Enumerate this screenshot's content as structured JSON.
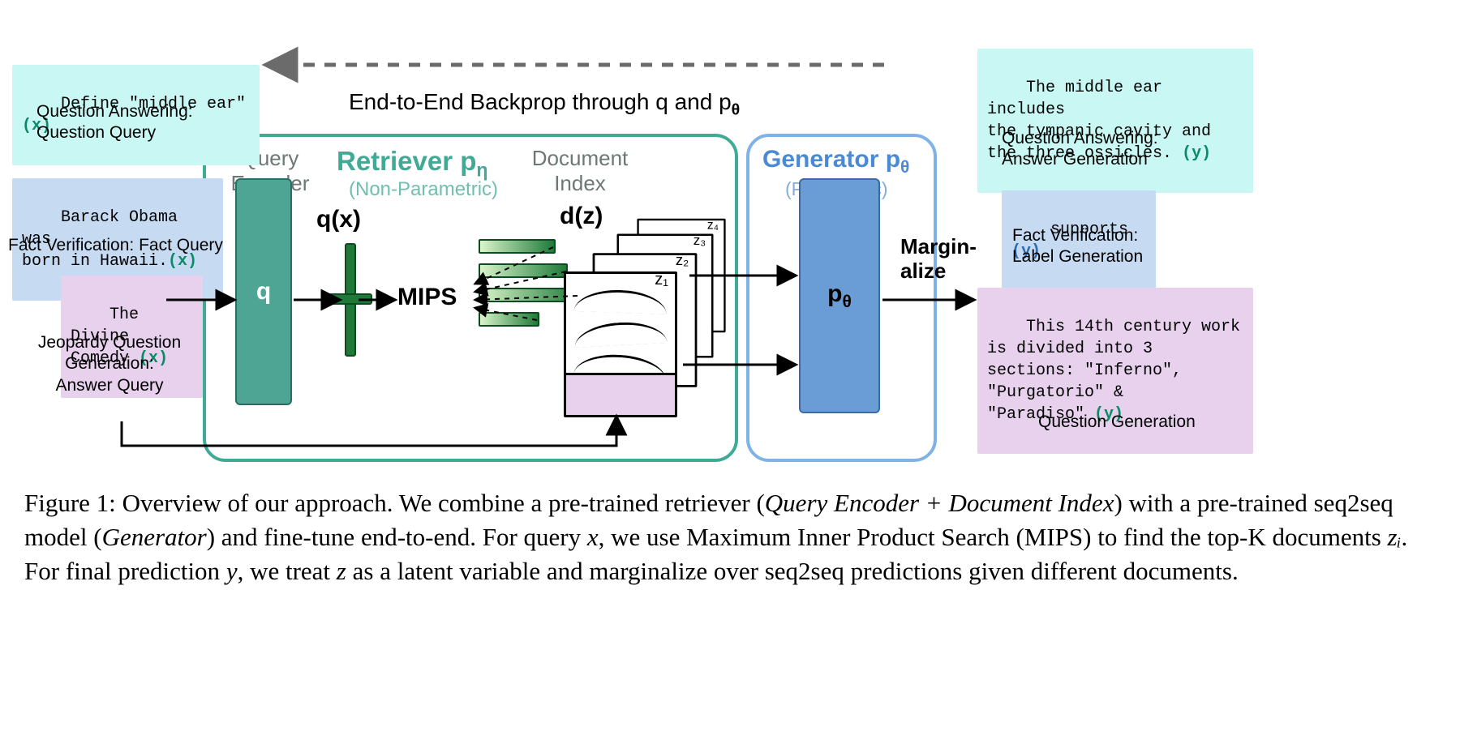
{
  "backprop_text": "End-to-End Backprop through q and p",
  "backprop_sub": "θ",
  "retriever": {
    "title_prefix": "Retriever p",
    "title_sub": "η",
    "subtitle": "(Non-Parametric)"
  },
  "query_encoder": {
    "title": "Query Encoder",
    "block_label": "q"
  },
  "doc_index": {
    "title": "Document Index"
  },
  "generator": {
    "title_prefix": "Generator p",
    "title_sub": "θ",
    "subtitle": "(Parametric)",
    "block_prefix": "p",
    "block_sub": "θ"
  },
  "math": {
    "qx": "q(x)",
    "dz": "d(z)",
    "mips": "MIPS",
    "marginalize_l1": "Margin-",
    "marginalize_l2": "alize",
    "z_labels": [
      "z₁",
      "z₂",
      "z₃",
      "z₄"
    ]
  },
  "left_inputs": [
    {
      "kind": "cyan",
      "text": "Define \"middle ear\"",
      "label": "Question Answering:\nQuestion Query"
    },
    {
      "kind": "blue",
      "text": "Barack Obama was\nborn in Hawaii.",
      "label": "Fact Verification: Fact Query"
    },
    {
      "kind": "purple",
      "text": "The Divine\nComedy ",
      "label": "Jeopardy Question\nGeneration:\nAnswer Query"
    }
  ],
  "right_outputs": [
    {
      "kind": "cyan",
      "text": "The middle ear includes\nthe tympanic cavity and\nthe three ossicles.",
      "label": "Question Answering:\nAnswer Generation"
    },
    {
      "kind": "blue",
      "text": "supports ",
      "label": "Fact Verification:\nLabel Generation"
    },
    {
      "kind": "purple",
      "text": "This 14th century work\nis divided into 3\nsections: \"Inferno\",\n\"Purgatorio\" &\n\"Paradiso\"",
      "label": "Question Generation"
    }
  ],
  "x_tag": "(x)",
  "y_tag": "(y)",
  "caption": {
    "fig_label": "Figure 1:",
    "body": " Overview of our approach. We combine a pre-trained retriever (",
    "em1": "Query Encoder + Document Index",
    "mid1": ") with a pre-trained seq2seq model (",
    "em2": "Generator",
    "mid2": ") and fine-tune end-to-end. For query ",
    "varx": "x",
    "mid3": ", we use Maximum Inner Product Search (MIPS) to find the top-K documents ",
    "varz": "zᵢ",
    "mid4": ". For final prediction ",
    "vary": "y",
    "mid5": ", we treat ",
    "varz2": "z",
    "end": " as a latent variable and marginalize over seq2seq predictions given different documents."
  }
}
